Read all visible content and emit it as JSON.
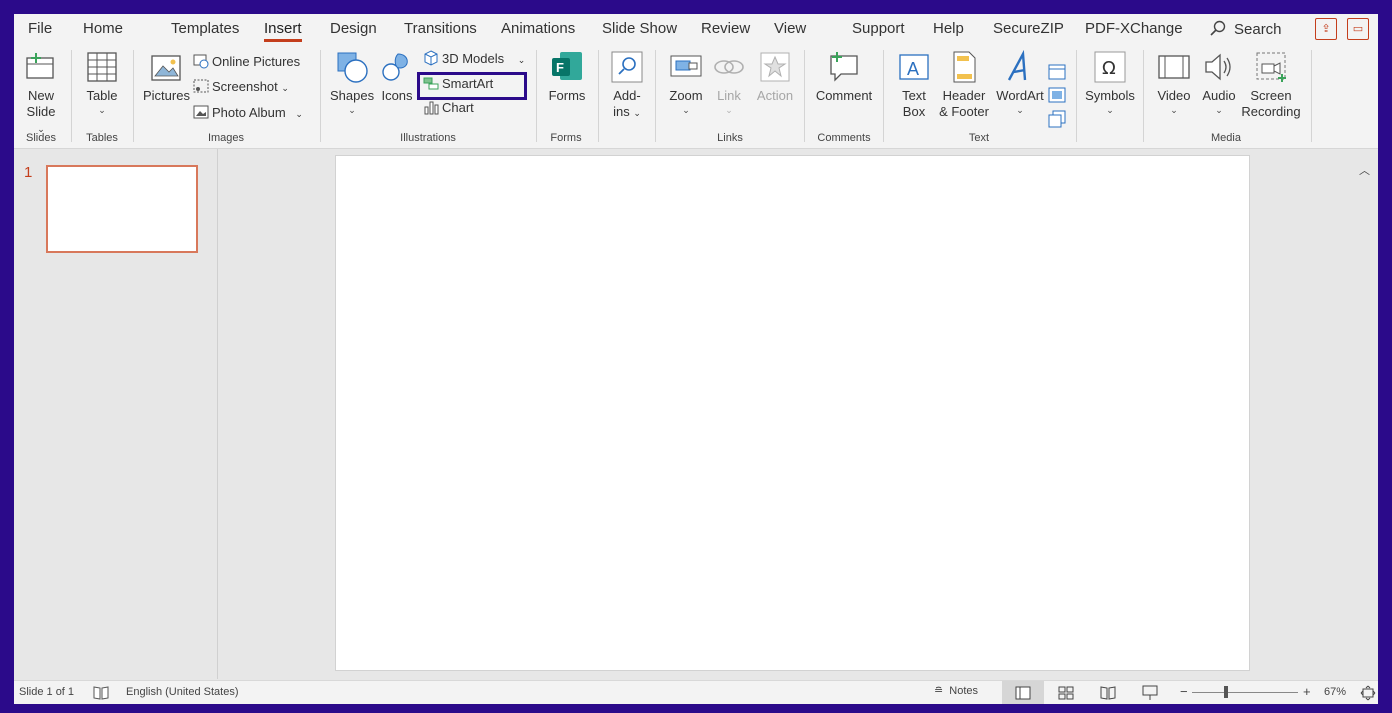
{
  "tabs": [
    "File",
    "Home",
    "Templates",
    "Insert",
    "Design",
    "Transitions",
    "Animations",
    "Slide Show",
    "Review",
    "View",
    "Support",
    "Help",
    "SecureZIP",
    "PDF-XChange"
  ],
  "active_tab": "Insert",
  "search_label": "Search",
  "groups": {
    "slides": {
      "label": "Slides",
      "new_slide_1": "New",
      "new_slide_2": "Slide"
    },
    "tables": {
      "label": "Tables",
      "table": "Table"
    },
    "images": {
      "label": "Images",
      "pictures": "Pictures",
      "online_pictures": "Online Pictures",
      "screenshot": "Screenshot",
      "photo_album": "Photo Album"
    },
    "illustrations": {
      "label": "Illustrations",
      "shapes": "Shapes",
      "icons": "Icons",
      "models_3d": "3D Models",
      "smartart": "SmartArt",
      "chart": "Chart"
    },
    "forms": {
      "label": "Forms",
      "forms": "Forms"
    },
    "addins": {
      "label": "",
      "addins_1": "Add-",
      "addins_2": "ins"
    },
    "links": {
      "label": "Links",
      "zoom": "Zoom",
      "link": "Link",
      "action": "Action"
    },
    "comments": {
      "label": "Comments",
      "comment": "Comment"
    },
    "text": {
      "label": "Text",
      "textbox_1": "Text",
      "textbox_2": "Box",
      "header_1": "Header",
      "header_2": "& Footer",
      "wordart": "WordArt"
    },
    "symbols": {
      "symbols": "Symbols"
    },
    "media": {
      "label": "Media",
      "video": "Video",
      "audio": "Audio",
      "screen_1": "Screen",
      "screen_2": "Recording"
    }
  },
  "slide_number": "1",
  "status": {
    "slide_info": "Slide 1 of 1",
    "language": "English (United States)",
    "notes": "Notes",
    "zoom": "67%"
  },
  "colors": {
    "accent": "#c43e1c",
    "frame": "#2b0a8a",
    "highlight_border": "#2b0a8a"
  }
}
